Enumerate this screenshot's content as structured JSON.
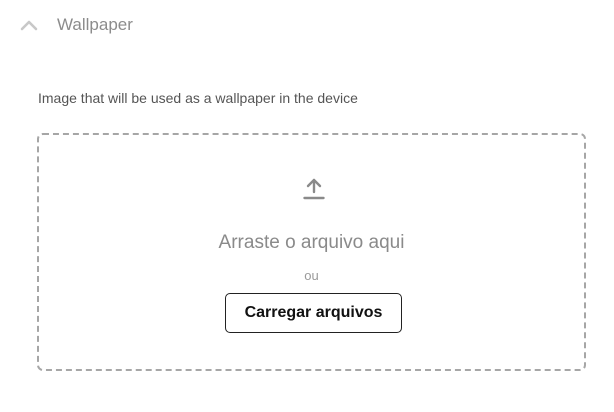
{
  "section": {
    "title": "Wallpaper",
    "icon": "chevron-up-icon"
  },
  "description": "Image that will be used as a wallpaper in the device",
  "dropzone": {
    "icon": "upload-icon",
    "drag_text": "Arraste o arquivo aqui",
    "or_text": "ou",
    "button_label": "Carregar arquivos"
  },
  "colors": {
    "muted_text": "#8c8c8c",
    "border": "#a6a6a6",
    "button_border": "#222222"
  }
}
